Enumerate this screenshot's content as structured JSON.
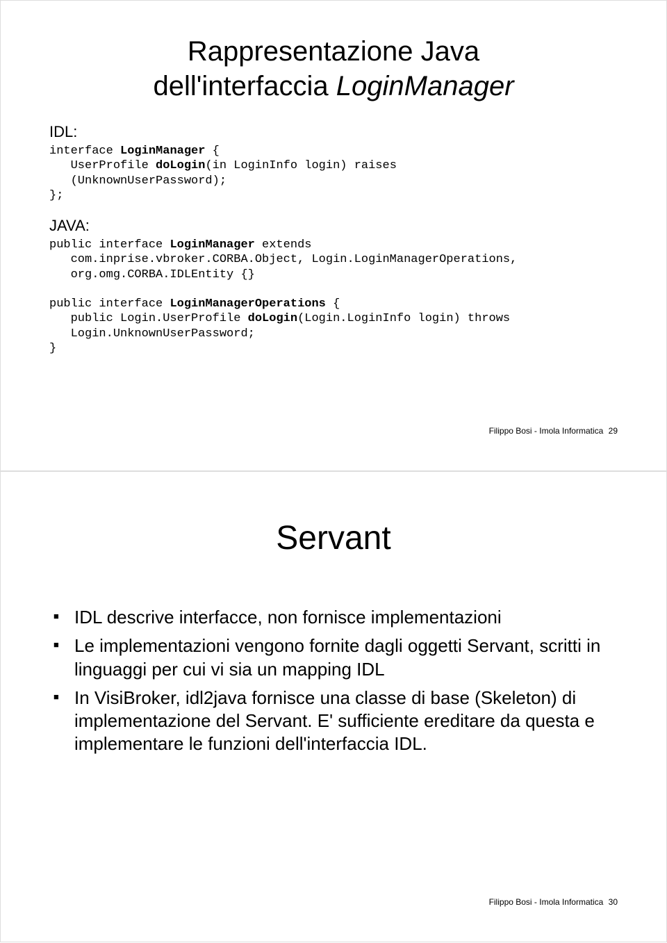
{
  "slide1": {
    "title_line1": "Rappresentazione Java",
    "title_line2a": "dell'interfaccia ",
    "title_line2b": "LoginManager",
    "idl_label": "IDL:",
    "java_label": "JAVA:",
    "idl_code": {
      "l1a": "interface ",
      "l1b": "LoginManager",
      "l1c": " {",
      "l2a": "   UserProfile ",
      "l2b": "doLogin",
      "l2c": "(in LoginInfo login) raises",
      "l3": "   (UnknownUserPassword);",
      "l4": "};"
    },
    "java_code": {
      "l1a": "public interface ",
      "l1b": "LoginManager",
      "l1c": " extends",
      "l2": "   com.inprise.vbroker.CORBA.Object, Login.LoginManagerOperations,",
      "l3": "   org.omg.CORBA.IDLEntity {}",
      "blank": "",
      "l4a": "public interface ",
      "l4b": "LoginManagerOperations",
      "l4c": " {",
      "l5a": "   public Login.UserProfile ",
      "l5b": "doLogin",
      "l5c": "(Login.LoginInfo login) throws",
      "l6": "   Login.UnknownUserPassword;",
      "l7": "}"
    },
    "footer_label": "Filippo Bosi - Imola Informatica",
    "footer_num": "29"
  },
  "slide2": {
    "title": "Servant",
    "bullets": [
      "IDL descrive interfacce, non fornisce implementazioni",
      "Le implementazioni vengono fornite dagli oggetti Servant, scritti in linguaggi per cui vi sia un mapping IDL",
      "In VisiBroker, idl2java fornisce una classe di base (Skeleton) di implementazione del Servant. E' sufficiente ereditare da questa e implementare le funzioni dell'interfaccia IDL."
    ],
    "footer_label": "Filippo Bosi - Imola Informatica",
    "footer_num": "30"
  }
}
